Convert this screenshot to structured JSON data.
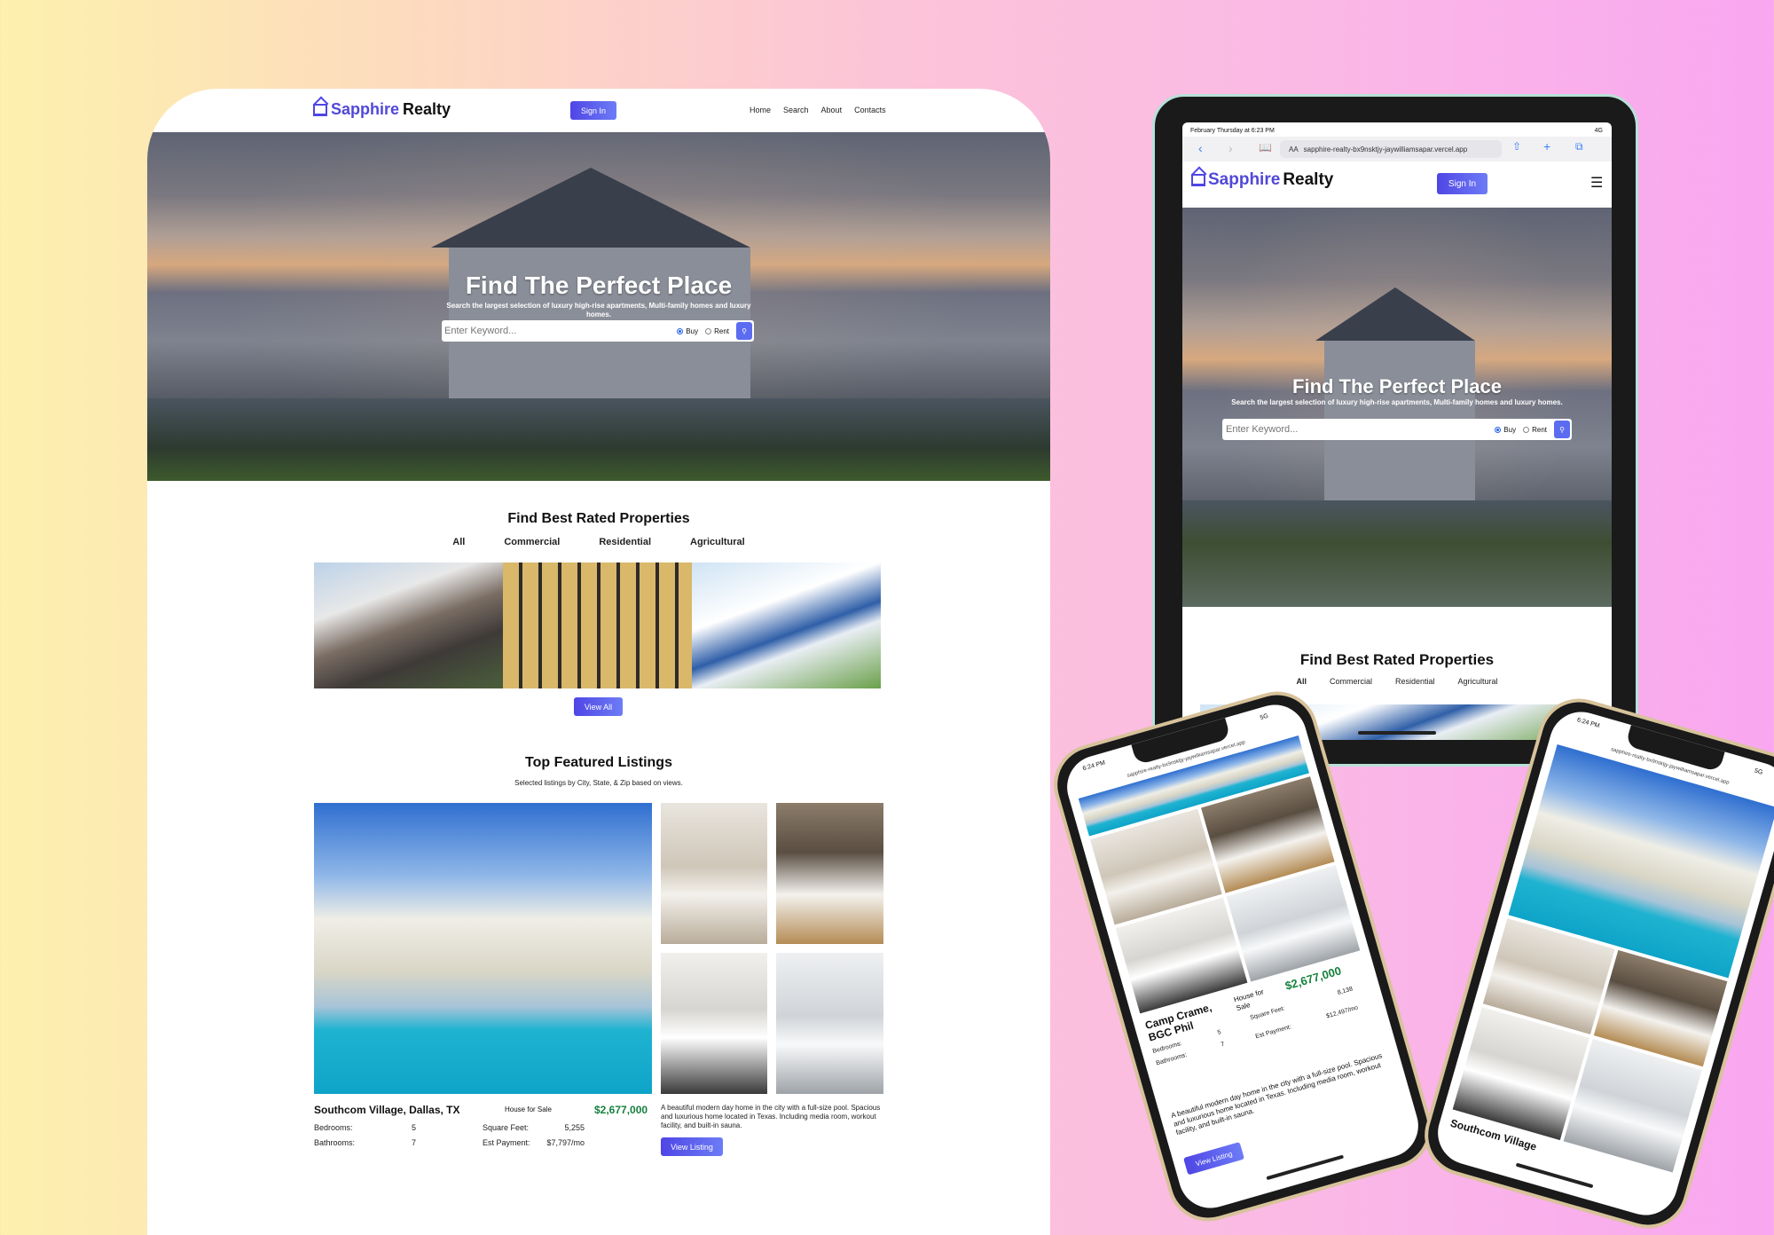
{
  "brand": {
    "name_a": "Sapphire",
    "name_b": "Realty"
  },
  "desktop": {
    "signin": "Sign In",
    "nav": [
      "Home",
      "Search",
      "About",
      "Contacts"
    ],
    "hero": {
      "title": "Find The Perfect Place",
      "subtitle": "Search the largest selection of luxury high-rise apartments, Multi-family homes and luxury homes.",
      "search_placeholder": "Enter Keyword...",
      "radio_buy": "Buy",
      "radio_rent": "Rent"
    },
    "best_rated": {
      "title": "Find Best Rated Properties",
      "tabs": [
        "All",
        "Commercial",
        "Residential",
        "Agricultural"
      ],
      "view_all": "View All"
    },
    "featured": {
      "title": "Top Featured Listings",
      "subtitle": "Selected listings by City, State, & Zip based on views.",
      "listing": {
        "name": "Southcom Village, Dallas, TX",
        "type": "House for Sale",
        "price": "$2,677,000",
        "bedrooms_label": "Bedrooms:",
        "bedrooms": "5",
        "bathrooms_label": "Bathrooms:",
        "bathrooms": "7",
        "sqft_label": "Square Feet:",
        "sqft": "5,255",
        "payment_label": "Est Payment:",
        "payment": "$7,797/mo",
        "description": "A beautiful modern day home in the city with a full-size pool. Spacious and luxurious home located in Texas. Including media room, workout facility, and built-in sauna.",
        "cta": "View Listing"
      }
    }
  },
  "tablet": {
    "status_time": "February Thursday at 6:23 PM",
    "status_right": "4G",
    "url": "sapphire-realty-bx9nsktjy-jaywilliamsapar.vercel.app",
    "aa": "AA",
    "signin": "Sign In",
    "hero_title": "Find The Perfect Place",
    "hero_subtitle": "Search the largest selection of luxury high-rise apartments, Multi-family homes and luxury homes.",
    "search_placeholder": "Enter Keyword...",
    "radio_buy": "Buy",
    "radio_rent": "Rent",
    "section_title": "Find Best Rated Properties",
    "tabs": [
      "All",
      "Commercial",
      "Residential",
      "Agricultural"
    ]
  },
  "phone1": {
    "time": "6:24 PM",
    "net": "5G",
    "url": "sapphire-realty-bx9nsktjy-jaywilliamsapar.vercel.app",
    "name": "Camp Crame, BGC Phil",
    "type": "House for Sale",
    "price": "$2,677,000",
    "bedrooms_label": "Bedrooms:",
    "bedrooms": "5",
    "bathrooms_label": "Bathrooms:",
    "bathrooms": "7",
    "sqft_label": "Square Feet:",
    "sqft": "8,138",
    "payment_label": "Est Payment:",
    "payment": "$12,497/mo",
    "description": "A beautiful modern day home in the city with a full-size pool. Spacious and luxurious home located in Texas. Including media room, workout facility, and built-in sauna.",
    "cta": "View Listing"
  },
  "phone2": {
    "time": "6:24 PM",
    "net": "5G",
    "url": "sapphire-realty-bx9nsktjy-jaywilliamsapar.vercel.app",
    "partial_name": "Southcom Village"
  }
}
